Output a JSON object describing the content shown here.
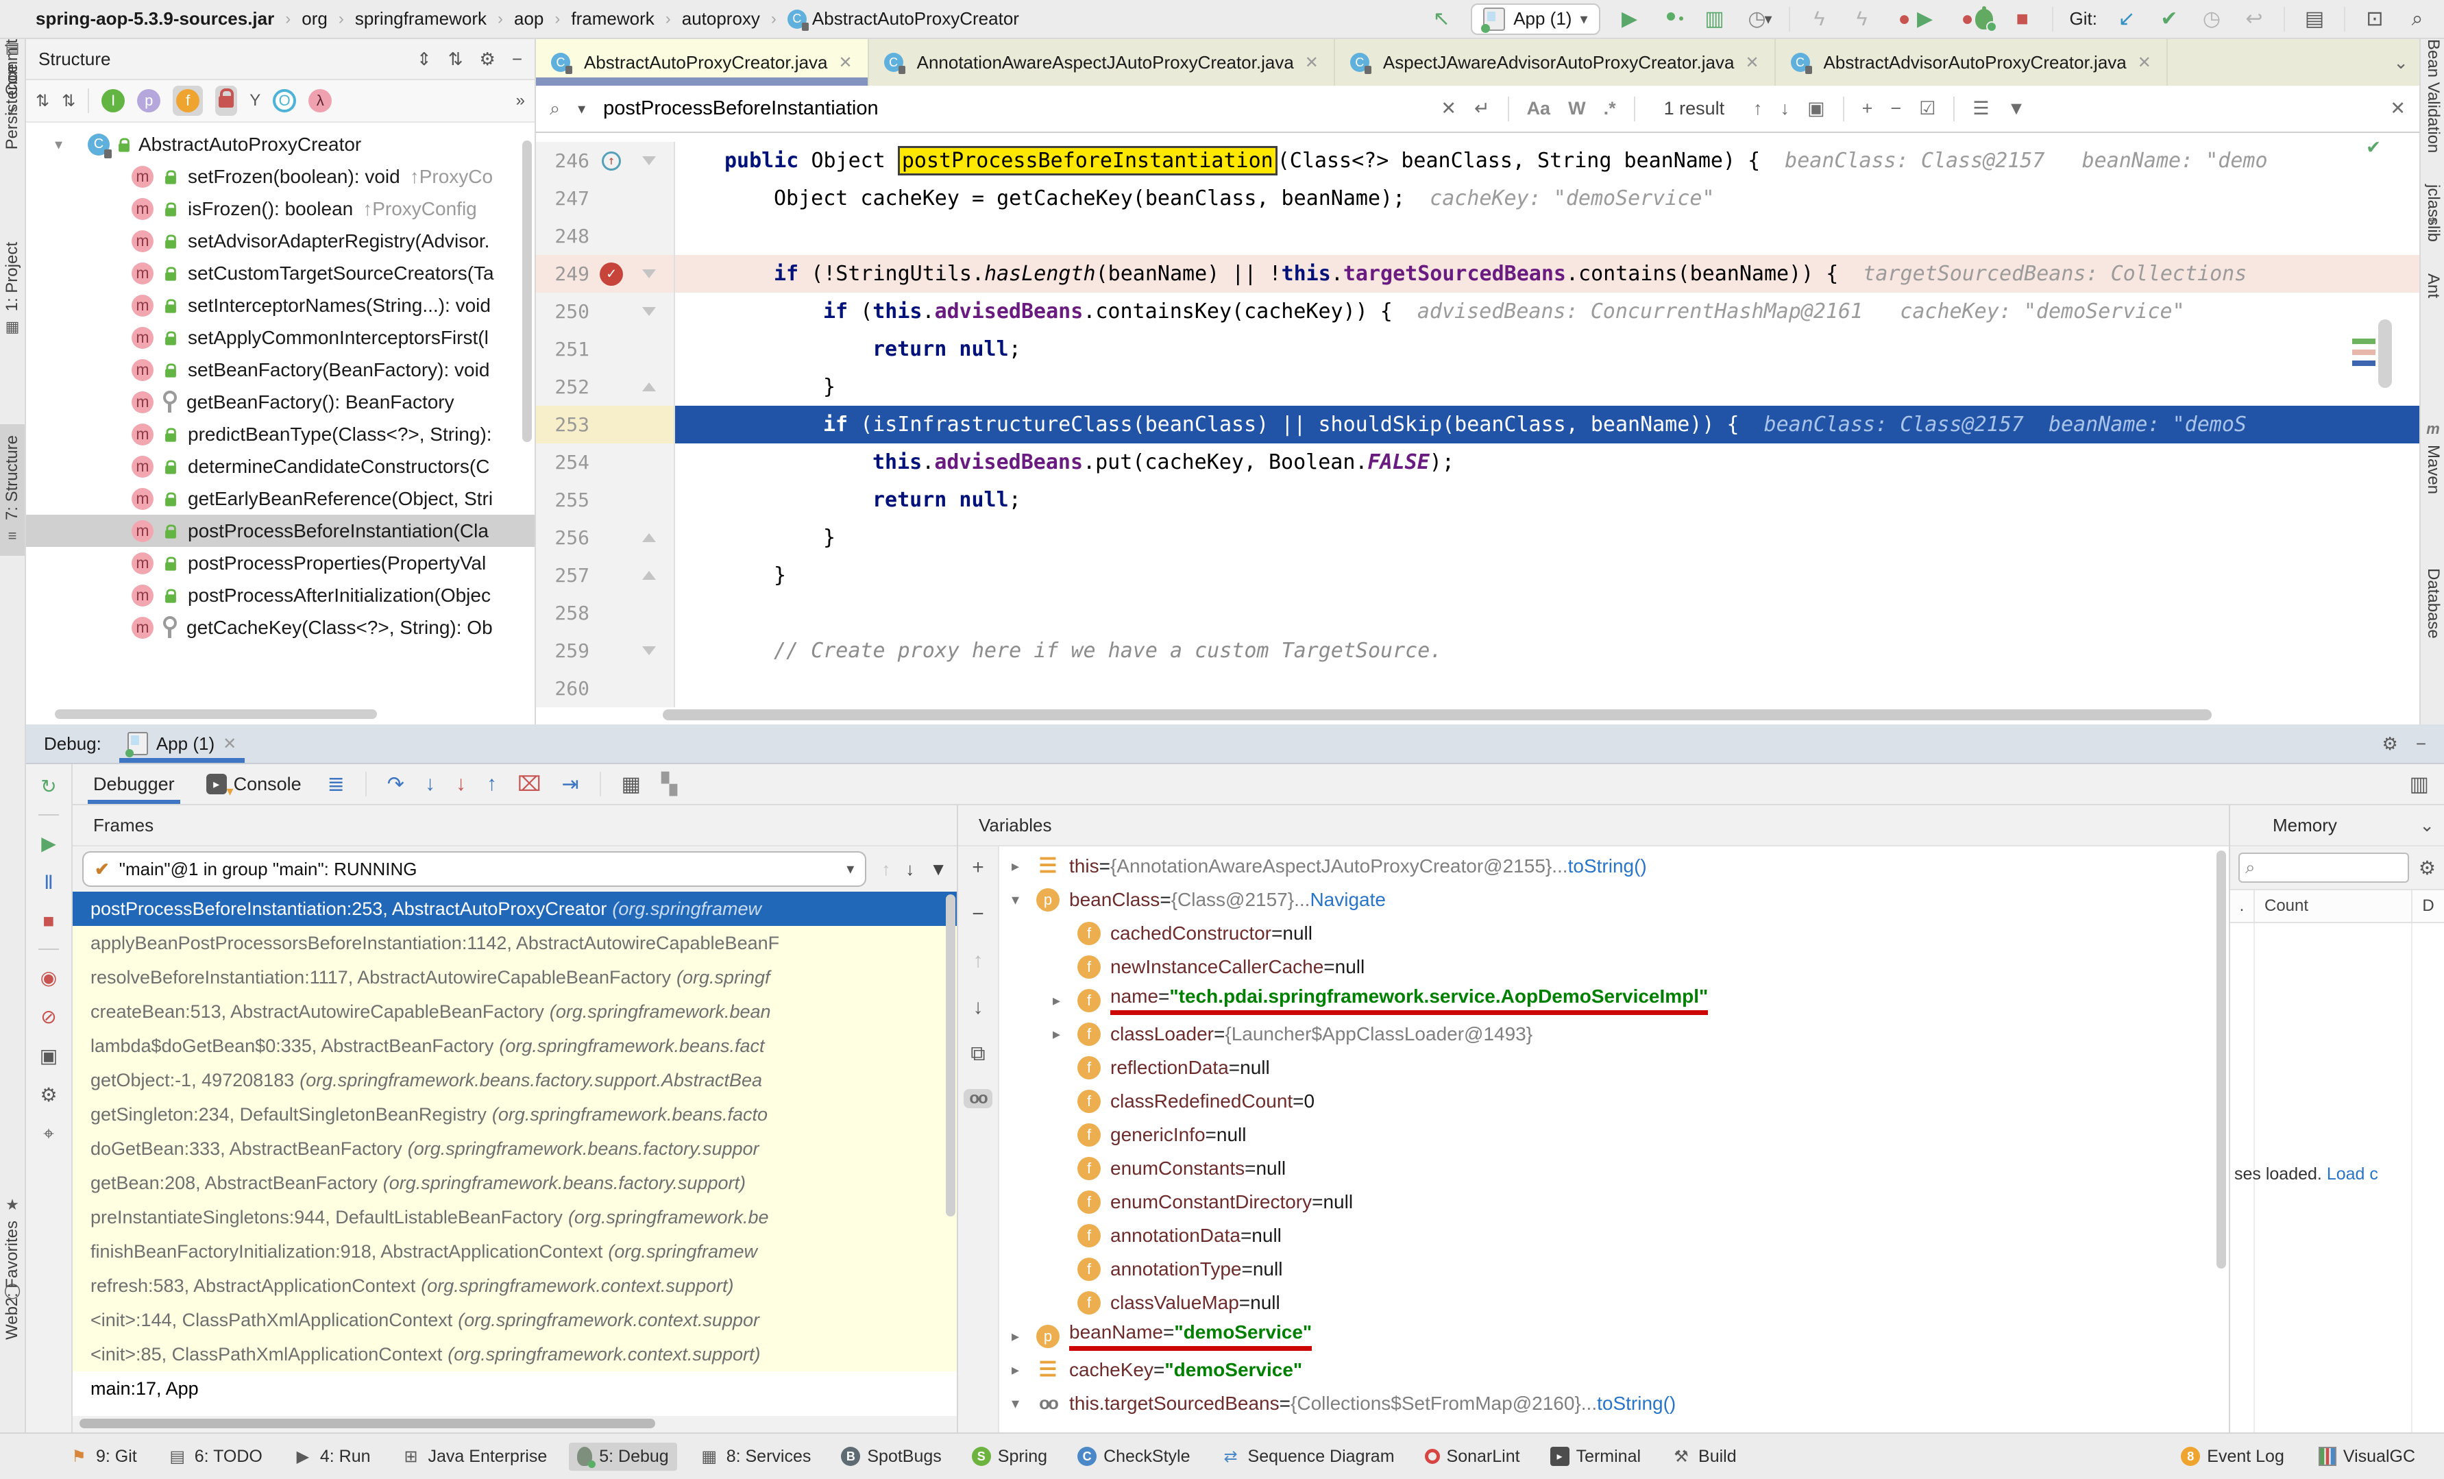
{
  "glyphs": {
    "chevron": "›",
    "back": "↖",
    "run": "▶",
    "coverage": "▥",
    "profiler": "◷",
    "dropdown": "▾",
    "bolt": "ϟ",
    "dot": "●",
    "stop": "■",
    "git_update": "↙",
    "check": "✔",
    "clock": "◷",
    "rollback": "↩",
    "toolbox": "▤",
    "term_run": "⊡",
    "magnifier": "⌕",
    "close": "✕",
    "enter": "↵",
    "up": "↑",
    "down": "↓",
    "select_all": "▣",
    "plus": "+",
    "minus": "−",
    "check_all": "☑",
    "multiline": "☰",
    "filter": "▼",
    "expand_all": "⇕",
    "collapse_all": "⇅",
    "gear": "⚙",
    "hide": "−",
    "more": "»",
    "sort_vis": "⇅",
    "sort_az": "⇅",
    "arrow_down": "▾",
    "arrow_right": "▸",
    "chevron_down": "⌄",
    "rerun": "↻",
    "resume": "▶",
    "pause": "Ⅱ",
    "view_bp": "◉",
    "mute_bp": "⊘",
    "camera": "▣",
    "pin": "⌖",
    "threads": "≣",
    "step_over": "↷",
    "step_into": "↓",
    "force_step_into": "↓",
    "step_out": "↑",
    "drop_frame": "⌧",
    "run_to_cursor": "⇥",
    "evaluate": "▦",
    "layout": "▚",
    "copy": "⧉",
    "glasses": "oo",
    "funnel": "▼",
    "inherited": "I",
    "properties": "p",
    "fields": "f",
    "ungroup": "Y",
    "anonymous": "O",
    "lambda": "λ"
  },
  "topbar": {
    "breadcrumbs": [
      {
        "t": "spring-aop-5.3.9-sources.jar",
        "cls": "b"
      },
      {
        "sep": "›",
        "t": "org"
      },
      {
        "sep": "›",
        "t": "springframework"
      },
      {
        "sep": "›",
        "t": "aop"
      },
      {
        "sep": "›",
        "t": "framework"
      },
      {
        "sep": "›",
        "t": "autoproxy"
      },
      {
        "sep": "›",
        "t": "AbstractAutoProxyCreator",
        "ci": true
      }
    ],
    "run_config": "App (1)",
    "git_label": "Git:"
  },
  "stripes": {
    "left_top": [
      {
        "dn": "tool-stripe-project",
        "label": "1: Project",
        "g": "▦"
      },
      {
        "dn": "tool-stripe-structure",
        "label": "7: Structure",
        "g": "≡",
        "cls": "sel"
      },
      {
        "dn": "tool-stripe-commit",
        "label": "Commit",
        "g": "✓"
      }
    ],
    "left_bottom": [
      {
        "dn": "tool-stripe-favorites",
        "label": "2: Favorites",
        "g": "★"
      },
      {
        "dn": "tool-stripe-web",
        "label": "Web",
        "g": "◯"
      },
      {
        "dn": "tool-stripe-persistence",
        "label": "Persistence",
        "g": "▤"
      }
    ],
    "right": [
      {
        "dn": "tool-stripe-jclasslib",
        "label": "jclasslib"
      },
      {
        "dn": "tool-stripe-pin",
        "g": "⌖"
      },
      {
        "dn": "tool-stripe-ant",
        "label": "Ant"
      },
      {
        "dn": "tool-stripe-maven",
        "label": "Maven",
        "g": "m",
        "gcls": "mvn"
      },
      {
        "dn": "tool-stripe-database",
        "label": "Database"
      },
      {
        "dn": "tool-stripe-bean-validation",
        "label": "Bean Validation"
      }
    ]
  },
  "structure": {
    "title": "Structure",
    "rows": [
      {
        "cls": "root",
        "arrow": "▾",
        "isclass": true,
        "lockg": true,
        "label": "AbstractAutoProxyCreator"
      },
      {
        "ism": true,
        "lockg": true,
        "label": "setFrozen(boolean): void",
        "sup": "↑ProxyCo"
      },
      {
        "ism": true,
        "lockg": true,
        "label": "isFrozen(): boolean",
        "sup": "↑ProxyConfig"
      },
      {
        "ism": true,
        "lockg": true,
        "label": "setAdvisorAdapterRegistry(Advisor."
      },
      {
        "ism": true,
        "lockg": true,
        "label": "setCustomTargetSourceCreators(Ta"
      },
      {
        "ism": true,
        "lockg": true,
        "label": "setInterceptorNames(String...): void"
      },
      {
        "ism": true,
        "lockg": true,
        "label": "setApplyCommonInterceptorsFirst(l"
      },
      {
        "ism": true,
        "lockg": true,
        "label": "setBeanFactory(BeanFactory): void"
      },
      {
        "ism": true,
        "lockk": true,
        "label": "getBeanFactory(): BeanFactory"
      },
      {
        "ism": true,
        "lockg": true,
        "label": "predictBeanType(Class<?>, String):"
      },
      {
        "ism": true,
        "lockg": true,
        "label": "determineCandidateConstructors(C"
      },
      {
        "ism": true,
        "lockg": true,
        "label": "getEarlyBeanReference(Object, Stri"
      },
      {
        "cls": "sel",
        "ism": true,
        "lockg": true,
        "label": "postProcessBeforeInstantiation(Cla"
      },
      {
        "ism": true,
        "lockg": true,
        "label": "postProcessProperties(PropertyVal"
      },
      {
        "ism": true,
        "lockg": true,
        "label": "postProcessAfterInitialization(Objec"
      },
      {
        "ism": true,
        "lockk": true,
        "label": "getCacheKey(Class<?>, String): Ob"
      }
    ]
  },
  "editor": {
    "tabs": [
      {
        "label": "AbstractAutoProxyCreator.java",
        "cls": "active"
      },
      {
        "label": "AnnotationAwareAspectJAutoProxyCreator.java"
      },
      {
        "label": "AspectJAwareAdvisorAutoProxyCreator.java"
      },
      {
        "label": "AbstractAdvisorAutoProxyCreator.java"
      }
    ],
    "search": {
      "query": "postProcessBeforeInstantiation",
      "match_case": "Aa",
      "words": "W",
      "regex": ".*",
      "results": "1 result"
    },
    "lines": [
      {
        "num": "246",
        "ic": "i1",
        "ov": true,
        "fold": "d",
        "segs": [
          {
            "c": "kw",
            "t": "public "
          },
          {
            "t": "Object "
          },
          {
            "c": "match",
            "t": "postProcessBeforeInstantiation"
          },
          {
            "t": "(Class<?> beanClass, String beanName) {"
          },
          {
            "c": "hint",
            "t": "beanClass: Class@2157   beanName: \"demo"
          }
        ]
      },
      {
        "num": "247",
        "ic": "i2",
        "segs": [
          {
            "t": "Object cacheKey = getCacheKey(beanClass, beanName);"
          },
          {
            "c": "hint",
            "t": "cacheKey: \"demoService\""
          }
        ]
      },
      {
        "num": "248",
        "segs": []
      },
      {
        "num": "249",
        "ic": "i2",
        "row": "bp",
        "bp": true,
        "fold": "d",
        "segs": [
          {
            "c": "kw",
            "t": "if "
          },
          {
            "t": "(!StringUtils."
          },
          {
            "c": "itl",
            "t": "hasLength"
          },
          {
            "t": "(beanName) || !"
          },
          {
            "c": "kw",
            "t": "this"
          },
          {
            "t": "."
          },
          {
            "c": "fld",
            "t": "targetSourcedBeans"
          },
          {
            "t": ".contains(beanName)) {"
          },
          {
            "c": "hint",
            "t": "targetSourcedBeans: Collections"
          }
        ]
      },
      {
        "num": "250",
        "ic": "i3",
        "fold": "d",
        "segs": [
          {
            "c": "kw",
            "t": "if "
          },
          {
            "t": "("
          },
          {
            "c": "kw",
            "t": "this"
          },
          {
            "t": "."
          },
          {
            "c": "fld",
            "t": "advisedBeans"
          },
          {
            "t": ".containsKey(cacheKey)) {"
          },
          {
            "c": "hint",
            "t": "advisedBeans: ConcurrentHashMap@2161   cacheKey: \"demoService\""
          }
        ]
      },
      {
        "num": "251",
        "ic": "i4",
        "segs": [
          {
            "c": "kw",
            "t": "return null"
          },
          {
            "t": ";"
          }
        ]
      },
      {
        "num": "252",
        "ic": "i3",
        "fold": "u",
        "segs": [
          {
            "t": "}"
          }
        ]
      },
      {
        "num": "253",
        "ic": "i3",
        "row": "exec",
        "segs": [
          {
            "c": "kw",
            "t": "if "
          },
          {
            "t": "(isInfrastructureClass(beanClass) || shouldSkip(beanClass, beanName)) {"
          },
          {
            "c": "hint",
            "t": "beanClass: Class@2157  beanName: \"demoS"
          }
        ]
      },
      {
        "num": "254",
        "ic": "i4",
        "segs": [
          {
            "c": "kw",
            "t": "this"
          },
          {
            "t": "."
          },
          {
            "c": "fld",
            "t": "advisedBeans"
          },
          {
            "t": ".put(cacheKey, Boolean."
          },
          {
            "c": "fldi",
            "t": "FALSE"
          },
          {
            "t": ");"
          }
        ]
      },
      {
        "num": "255",
        "ic": "i4",
        "segs": [
          {
            "c": "kw",
            "t": "return null"
          },
          {
            "t": ";"
          }
        ]
      },
      {
        "num": "256",
        "ic": "i3",
        "fold": "u",
        "segs": [
          {
            "t": "}"
          }
        ]
      },
      {
        "num": "257",
        "ic": "i2",
        "fold": "u",
        "segs": [
          {
            "t": "}"
          }
        ]
      },
      {
        "num": "258",
        "segs": []
      },
      {
        "num": "259",
        "ic": "i2",
        "fold": "d",
        "segs": [
          {
            "c": "cmt",
            "t": "// Create proxy here if we have a custom TargetSource."
          }
        ]
      },
      {
        "num": "260",
        "segs": []
      }
    ]
  },
  "debug": {
    "header_label": "Debug:",
    "session_tab": "App (1)",
    "tabs": {
      "debugger": "Debugger",
      "console": "Console"
    },
    "frames": {
      "title": "Frames",
      "thread": "\"main\"@1 in group \"main\": RUNNING",
      "rows": [
        {
          "cls": "sel",
          "text": "postProcessBeforeInstantiation:253, AbstractAutoProxyCreator",
          "pkg": "(org.springframew"
        },
        {
          "text": "applyBeanPostProcessorsBeforeInstantiation:1142, AbstractAutowireCapableBeanF"
        },
        {
          "text": "resolveBeforeInstantiation:1117, AbstractAutowireCapableBeanFactory",
          "pkg": "(org.springf"
        },
        {
          "text": "createBean:513, AbstractAutowireCapableBeanFactory",
          "pkg": "(org.springframework.bean"
        },
        {
          "text": "lambda$doGetBean$0:335, AbstractBeanFactory",
          "pkg": "(org.springframework.beans.fact"
        },
        {
          "text": "getObject:-1, 497208183",
          "pkg": "(org.springframework.beans.factory.support.AbstractBea"
        },
        {
          "text": "getSingleton:234, DefaultSingletonBeanRegistry",
          "pkg": "(org.springframework.beans.facto"
        },
        {
          "text": "doGetBean:333, AbstractBeanFactory",
          "pkg": "(org.springframework.beans.factory.suppor"
        },
        {
          "text": "getBean:208, AbstractBeanFactory",
          "pkg": "(org.springframework.beans.factory.support)"
        },
        {
          "text": "preInstantiateSingletons:944, DefaultListableBeanFactory",
          "pkg": "(org.springframework.be"
        },
        {
          "text": "finishBeanFactoryInitialization:918, AbstractApplicationContext",
          "pkg": "(org.springframew"
        },
        {
          "text": "refresh:583, AbstractApplicationContext",
          "pkg": "(org.springframework.context.support)"
        },
        {
          "text": "<init>:144, ClassPathXmlApplicationContext",
          "pkg": "(org.springframework.context.suppor"
        },
        {
          "text": "<init>:85, ClassPathXmlApplicationContext",
          "pkg": "(org.springframework.context.support)"
        },
        {
          "cls": "plain",
          "text": "main:17, App"
        }
      ]
    },
    "variables": {
      "title": "Variables",
      "rows": [
        {
          "arrow": "▸",
          "icls": "list",
          "itext": "☰",
          "name": "this",
          "eq": " = ",
          "ref": "{AnnotationAwareAspectJAutoProxyCreator@2155}",
          "dots": " ... ",
          "link": "toString()"
        },
        {
          "arrow": "▾",
          "icls": "p",
          "itext": "p",
          "name": "beanClass",
          "eq": " = ",
          "ref": "{Class@2157}",
          "dots": " ... ",
          "link": "Navigate"
        },
        {
          "rowcls": "ind1",
          "icls": "f",
          "itext": "f",
          "name": "cachedConstructor",
          "eq": " = ",
          "plain": "null"
        },
        {
          "rowcls": "ind1",
          "icls": "f",
          "itext": "f",
          "name": "newInstanceCallerCache",
          "eq": " = ",
          "plain": "null"
        },
        {
          "rowcls": "ind1",
          "arrow": "▸",
          "icls": "f",
          "itext": "f",
          "name": "name",
          "eq": " = ",
          "str": "\"tech.pdai.springframework.service.AopDemoServiceImpl\"",
          "ulcls": "ul"
        },
        {
          "rowcls": "ind1",
          "arrow": "▸",
          "icls": "f",
          "itext": "f",
          "name": "classLoader",
          "eq": " = ",
          "ref": "{Launcher$AppClassLoader@1493}"
        },
        {
          "rowcls": "ind1",
          "icls": "f",
          "itext": "f",
          "name": "reflectionData",
          "eq": " = ",
          "plain": "null"
        },
        {
          "rowcls": "ind1",
          "icls": "f",
          "itext": "f",
          "name": "classRedefinedCount",
          "eq": " = ",
          "plain": "0"
        },
        {
          "rowcls": "ind1",
          "icls": "f",
          "itext": "f",
          "name": "genericInfo",
          "eq": " = ",
          "plain": "null"
        },
        {
          "rowcls": "ind1",
          "icls": "f",
          "itext": "f",
          "name": "enumConstants",
          "eq": " = ",
          "plain": "null"
        },
        {
          "rowcls": "ind1",
          "icls": "f",
          "itext": "f",
          "name": "enumConstantDirectory",
          "eq": " = ",
          "plain": "null"
        },
        {
          "rowcls": "ind1",
          "icls": "f",
          "itext": "f",
          "name": "annotationData",
          "eq": " = ",
          "plain": "null"
        },
        {
          "rowcls": "ind1",
          "icls": "f",
          "itext": "f",
          "name": "annotationType",
          "eq": " = ",
          "plain": "null"
        },
        {
          "rowcls": "ind1",
          "icls": "f",
          "itext": "f",
          "name": "classValueMap",
          "eq": " = ",
          "plain": "null"
        },
        {
          "arrow": "▸",
          "icls": "p",
          "itext": "p",
          "name": "beanName",
          "eq": " = ",
          "str": "\"demoService\"",
          "ulcls": "ul"
        },
        {
          "arrow": "▸",
          "icls": "list",
          "itext": "☰",
          "name": "cacheKey",
          "eq": " = ",
          "str": "\"demoService\""
        },
        {
          "arrow": "▾",
          "icls": "watch",
          "itext": "oo",
          "name": "this.targetSourcedBeans",
          "eq": " = ",
          "ref": "{Collections$SetFromMap@2160}",
          "dots": " ... ",
          "link": "toString()"
        }
      ]
    },
    "memory": {
      "title": "Memory",
      "col_dot": ".",
      "col_count": "Count",
      "col_diff": "D",
      "loaded_text": "ses loaded. ",
      "load_link": "Load c"
    }
  },
  "statusbar": {
    "items": [
      {
        "dn": "git-tool-button",
        "ic": "ic-flag",
        "g": "⚑",
        "label": "9: Git"
      },
      {
        "dn": "todo-tool-button",
        "g": "▤",
        "label": "6: TODO"
      },
      {
        "dn": "run-tool-button",
        "g": "▶",
        "label": "4: Run"
      },
      {
        "dn": "java-enterprise-tool-button",
        "g": "⊞",
        "label": "Java Enterprise"
      },
      {
        "dn": "debug-tool-button",
        "ic": "ic-bug",
        "g": "",
        "label": "5: Debug",
        "cls": "active"
      },
      {
        "dn": "services-tool-button",
        "g": "▦",
        "label": "8: Services"
      },
      {
        "dn": "spotbugs-tool-button",
        "ic": "ic-badge bg-dark",
        "g": "B",
        "label": "SpotBugs"
      },
      {
        "dn": "spring-tool-button",
        "ic": "ic-badge bg-green",
        "g": "S",
        "label": "Spring"
      },
      {
        "dn": "checkstyle-tool-button",
        "ic": "ic-badge bg-blue",
        "g": "C",
        "label": "CheckStyle"
      },
      {
        "dn": "sequence-diagram-tool-button",
        "ic": "ic-blue",
        "g": "⇄",
        "label": "Sequence Diagram"
      },
      {
        "dn": "sonarlint-tool-button",
        "ic": "ring-red",
        "g": "",
        "label": "SonarLint"
      },
      {
        "dn": "terminal-tool-button",
        "ic": "ic-term",
        "g": "▸",
        "label": "Terminal"
      },
      {
        "dn": "build-tool-button",
        "g": "⚒",
        "label": "Build"
      }
    ],
    "right_items": [
      {
        "dn": "event-log-button",
        "ic": "ic-badge bg-orange",
        "g": "8",
        "label": "Event Log"
      },
      {
        "dn": "visualgc-button",
        "ic": "ic-gc",
        "g": "",
        "label": "VisualGC"
      }
    ]
  }
}
